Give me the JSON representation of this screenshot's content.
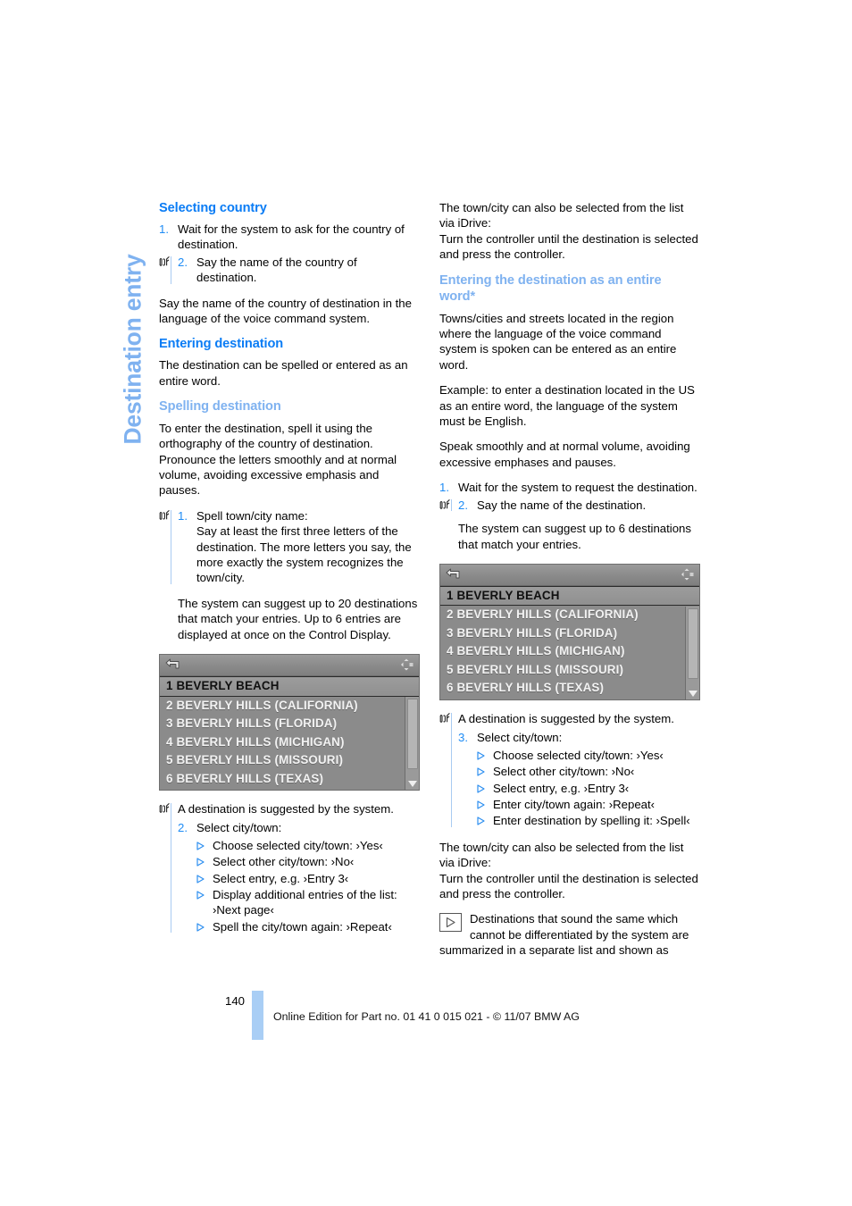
{
  "chapter": {
    "vertical_title": "Destination entry"
  },
  "left_column": {
    "heading_selecting_country": "Selecting country",
    "steps_country": [
      {
        "num": "1.",
        "text": "Wait for the system to ask for the country of destination."
      },
      {
        "num": "2.",
        "text": "Say the name of the country of destination."
      }
    ],
    "para_country_language": "Say the name of the country of destination in the language of the voice command system.",
    "heading_entering_destination": "Entering destination",
    "para_entering_destination": "The destination can be spelled or entered as an entire word.",
    "heading_spelling_destination": "Spelling destination",
    "para_spelling_intro": "To enter the destination, spell it using the orthography of the country of destination. Pronounce the letters smoothly and at normal volume, avoiding excessive emphasis and pauses.",
    "step_spell": {
      "num": "1.",
      "title": "Spell town/city name:",
      "body": "Say at least the first three letters of the destination. The more letters you say, the more exactly the system recognizes the town/city."
    },
    "para_suggest_20": "The system can suggest up to 20 destinations that match your entries. Up to 6 entries are displayed at once on the Control Display.",
    "caption_destination_suggested": "A destination is suggested by the system.",
    "step_select_city": {
      "num": "2.",
      "text": "Select city/town:"
    },
    "select_city_options": [
      "Choose selected city/town: ›Yes‹",
      "Select other city/town: ›No‹",
      "Select entry, e.g. ›Entry 3‹",
      "Display additional entries of the list: ›Next page‹",
      "Spell the city/town again: ›Repeat‹"
    ]
  },
  "right_column": {
    "para_idrive_top": "The town/city can also be selected from the list via iDrive:",
    "para_idrive_top2": "Turn the controller until the destination is selected and press the controller.",
    "heading_entire_word": "Entering the destination as an entire word*",
    "para_entire_word_1": "Towns/cities and streets located in the region where the language of the voice command system is spoken can be entered as an entire word.",
    "para_entire_word_2": "Example: to enter a destination located in the US as an entire word, the language of the system must be English.",
    "para_entire_word_3": "Speak smoothly and at normal volume, avoiding excessive emphases and pauses.",
    "steps_entire_word": [
      {
        "num": "1.",
        "text": "Wait for the system to request the destination."
      },
      {
        "num": "2.",
        "text": "Say the name of the destination."
      }
    ],
    "para_suggest_6": "The system can suggest up to 6 destinations that match your entries.",
    "caption_destination_suggested": "A destination is suggested by the system.",
    "step_select_city": {
      "num": "3.",
      "text": "Select city/town:"
    },
    "select_city_options": [
      "Choose selected city/town: ›Yes‹",
      "Select other city/town: ›No‹",
      "Select entry, e.g. ›Entry 3‹",
      "Enter city/town again: ›Repeat‹",
      "Enter destination by spelling it: ›Spell‹"
    ],
    "para_idrive_bottom": "The town/city can also be selected from the list via iDrive:",
    "para_idrive_bottom2": "Turn the controller until the destination is selected and press the controller.",
    "note_text": "Destinations that sound the same which cannot be differentiated by the system are summarized in a separate list and shown as"
  },
  "nav_display": {
    "back_icon": "back-arrow-icon",
    "crosshair_icon": "controller-crosshair-icon",
    "rows": [
      {
        "index": "1",
        "label": "BEVERLY BEACH",
        "selected": true
      },
      {
        "index": "2",
        "label": "BEVERLY HILLS (CALIFORNIA)",
        "selected": false
      },
      {
        "index": "3",
        "label": "BEVERLY HILLS (FLORIDA)",
        "selected": false
      },
      {
        "index": "4",
        "label": "BEVERLY HILLS (MICHIGAN)",
        "selected": false
      },
      {
        "index": "5",
        "label": "BEVERLY HILLS (MISSOURI)",
        "selected": false
      },
      {
        "index": "6",
        "label": "BEVERLY HILLS (TEXAS)",
        "selected": false
      }
    ]
  },
  "footer": {
    "page_number": "140",
    "credit": "Online Edition for Part no. 01 41 0 015 021 - © 11/07 BMW AG"
  },
  "colors": {
    "heading_primary": "#0A7CF5",
    "heading_secondary": "#7FB2F0",
    "step_number": "#1E8CF5",
    "bullet": "#2E8FF0",
    "footer_bar": "#A9CEF5",
    "display_background": "#8b8b8b"
  }
}
